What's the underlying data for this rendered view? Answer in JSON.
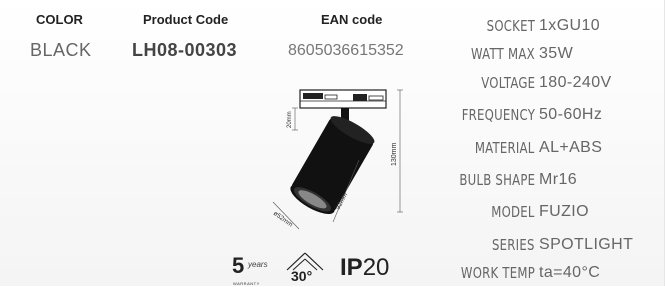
{
  "header": {
    "color_label": "COLOR",
    "code_label": "Product Code",
    "ean_label": "EAN code",
    "color_value": "BLACK",
    "code_value": "LH08-00303",
    "ean_value": "8605036615352"
  },
  "specs": [
    {
      "label": "SOCKET",
      "value": "1xGU10"
    },
    {
      "label": "WATT MAX",
      "value": "35W"
    },
    {
      "label": "VOLTAGE",
      "value": "180-240V"
    },
    {
      "label": "FREQUENCY",
      "value": "50-60Hz"
    },
    {
      "label": "MATERIAL",
      "value": "AL+ABS"
    },
    {
      "label": "BULB SHAPE",
      "value": "Mr16"
    },
    {
      "label": "MODEL",
      "value": "FUZIO"
    },
    {
      "label": "SERIES",
      "value": "SPOTLIGHT"
    },
    {
      "label": "WORK TEMP",
      "value": "ta=40°C"
    }
  ],
  "drawing": {
    "dim_height": "130mm",
    "dim_arm": "20mm",
    "dim_length": "92mm",
    "dim_diameter": "ø52mm"
  },
  "badges": {
    "warranty_number": "5",
    "warranty_unit": "years",
    "warranty_text": "WARRANTY",
    "beam_angle": "30°",
    "ip_prefix": "IP",
    "ip_value": "20"
  },
  "colors": {
    "text_dark": "#222222",
    "text_grey": "#666666",
    "background": "#ffffff"
  }
}
